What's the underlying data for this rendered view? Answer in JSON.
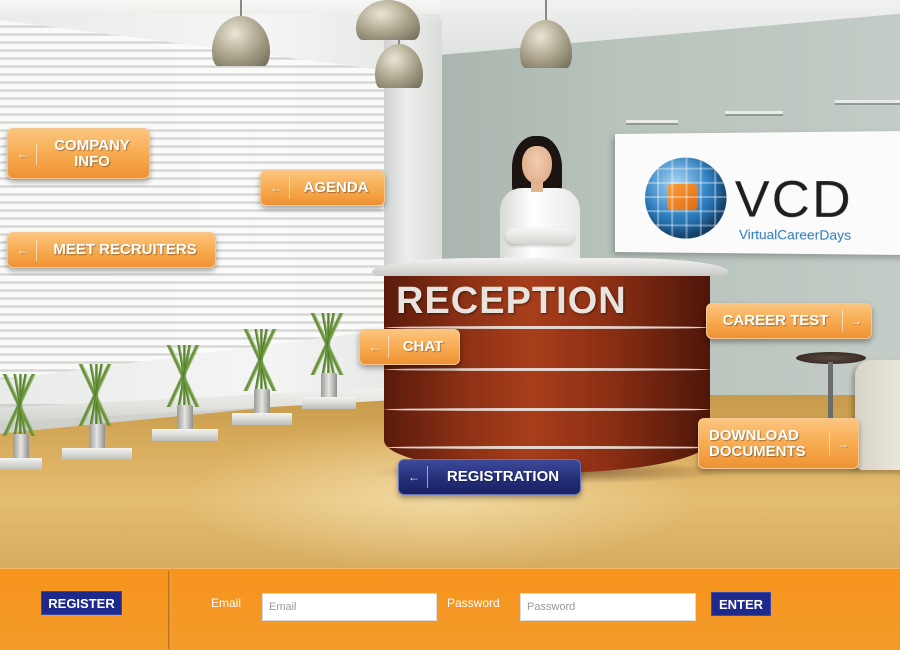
{
  "scene": {
    "desk_sign": "RECEPTION",
    "logo": {
      "name": "VCD",
      "subtitle": "VirtualCareerDays"
    }
  },
  "nav": {
    "company_info": {
      "line1": "COMPANY",
      "line2": "INFO"
    },
    "agenda": "AGENDA",
    "meet_recruiters": "MEET RECRUITERS",
    "chat": "CHAT",
    "career_test": "CAREER TEST",
    "download_documents": {
      "line1": "DOWNLOAD",
      "line2": "DOCUMENTS"
    },
    "registration": "REGISTRATION"
  },
  "login_bar": {
    "register_label": "REGISTER",
    "email_label": "Email",
    "email_placeholder": "Email",
    "password_label": "Password",
    "password_placeholder": "Password",
    "enter_label": "ENTER"
  },
  "colors": {
    "bar_orange": "#f7941d",
    "button_navy": "#1d2a8c",
    "nav_orange": "#f7a94d"
  },
  "icons": {
    "left_arrow": "arrow-left-icon",
    "right_arrow": "arrow-right-icon"
  }
}
